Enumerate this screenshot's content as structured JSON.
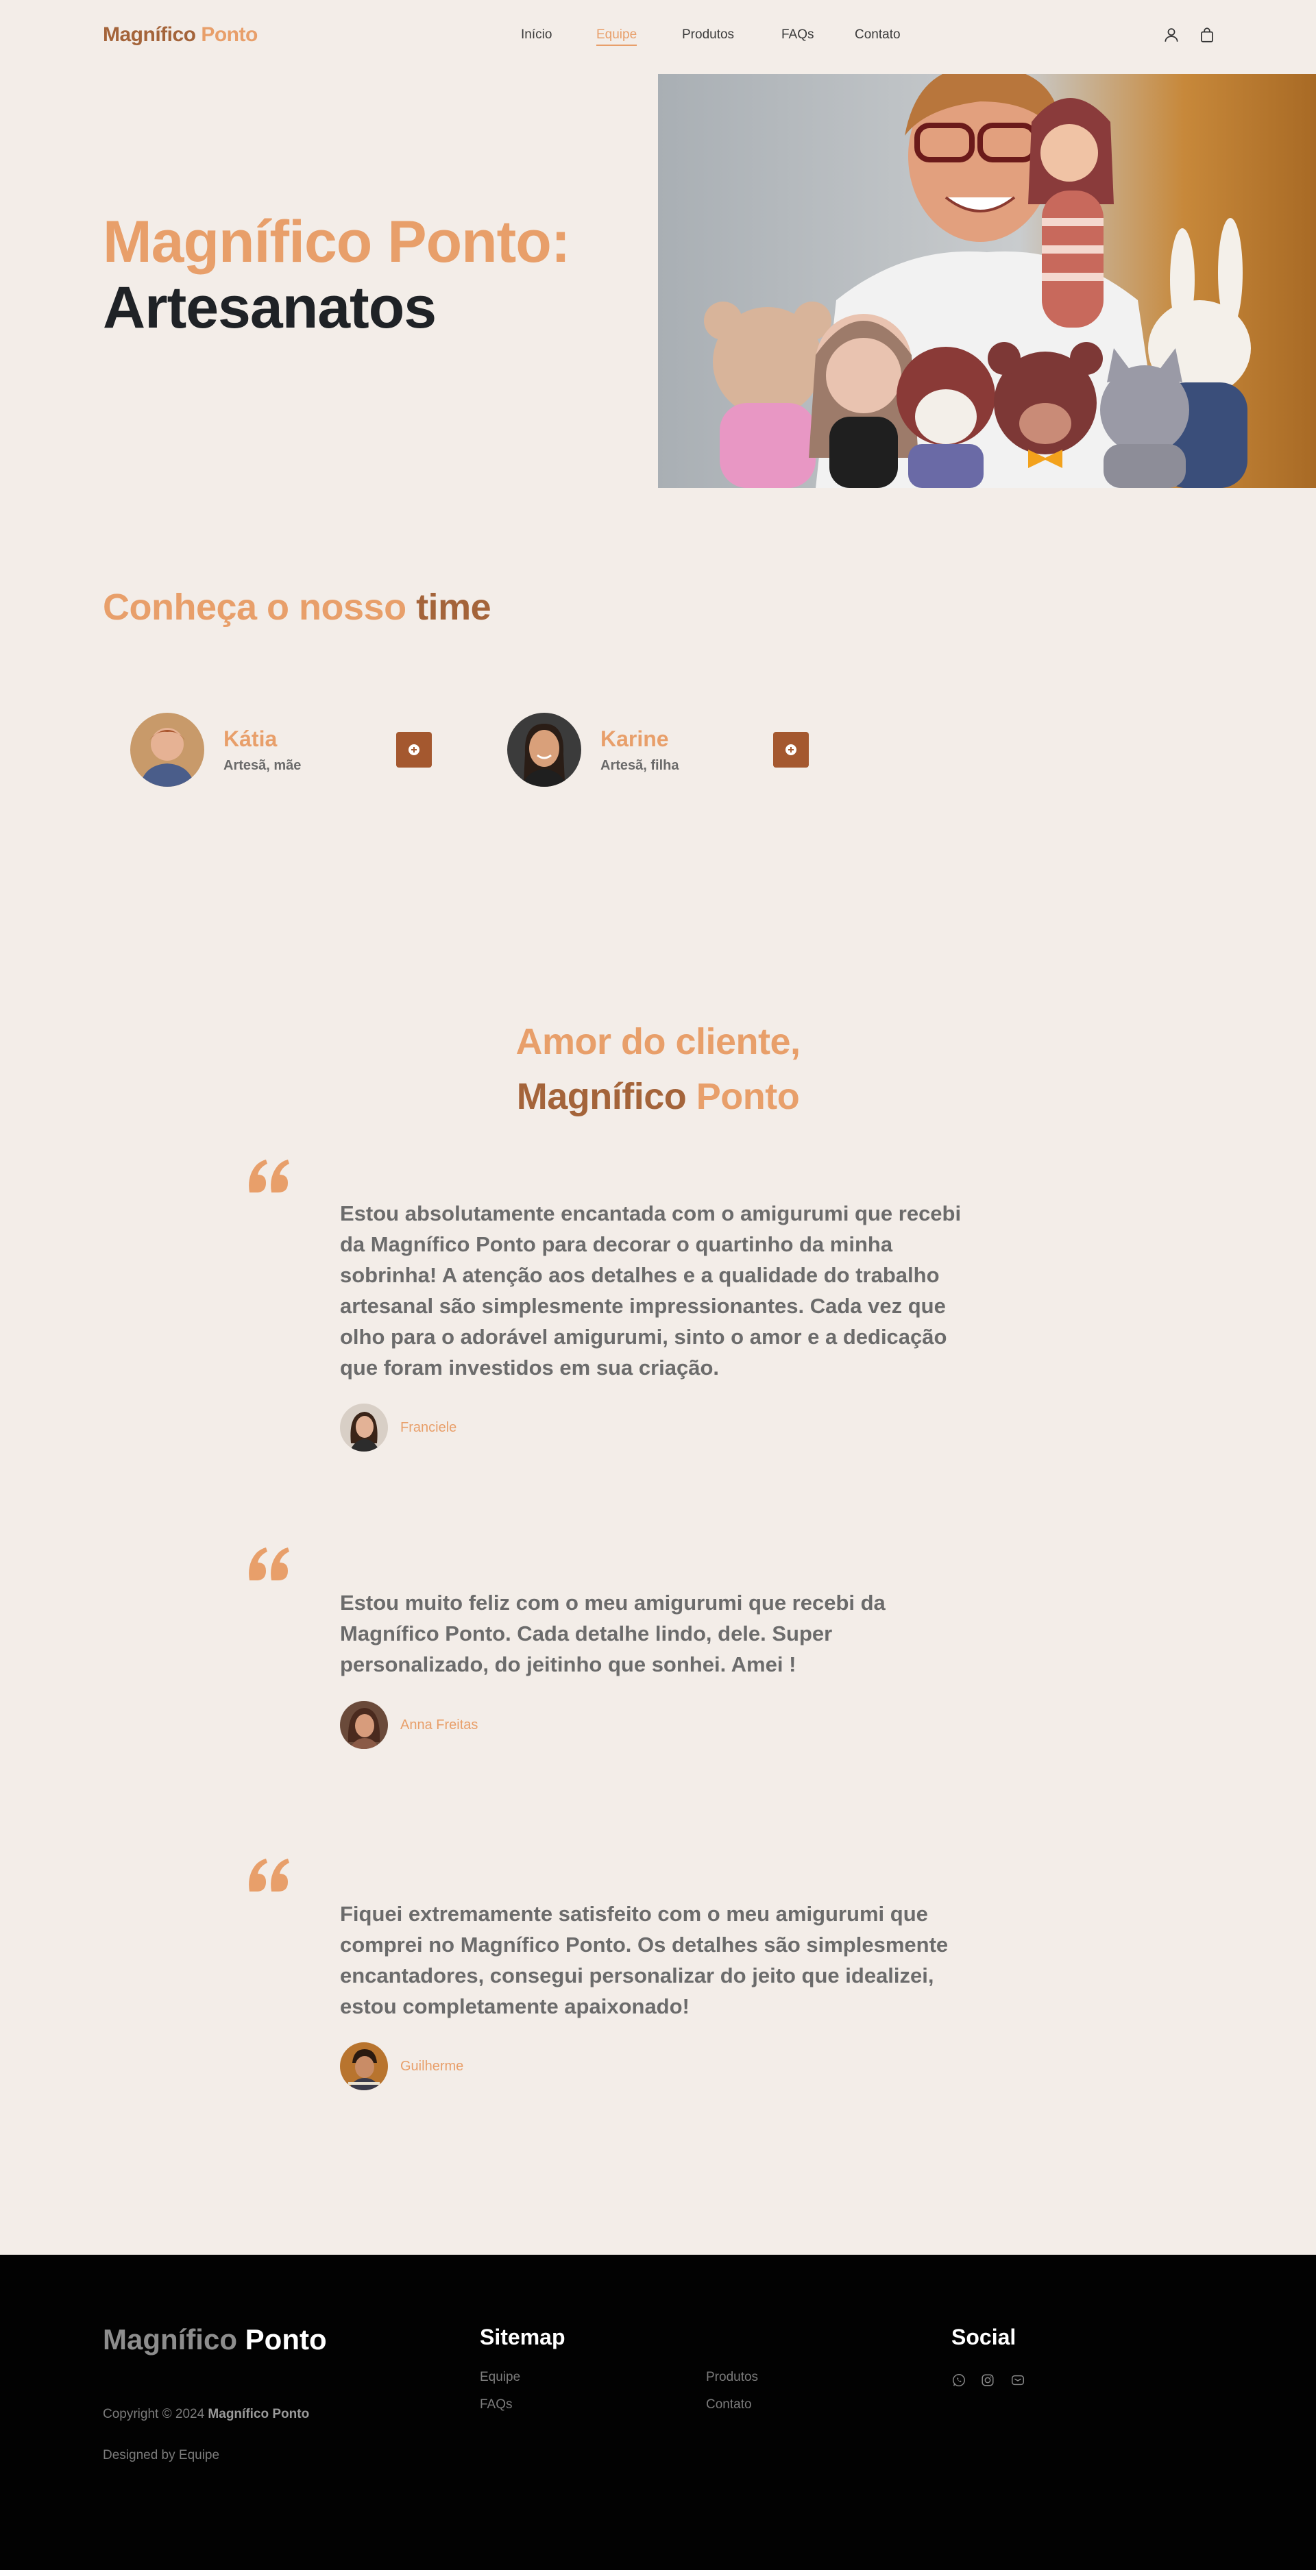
{
  "header": {
    "logo_a": "Magnífico",
    "logo_b": "Ponto",
    "nav": [
      "Início",
      "Equipe",
      "Produtos",
      "FAQs",
      "Contato"
    ],
    "active_nav": "Equipe",
    "icons": [
      "user-icon",
      "shopping-bag-icon"
    ]
  },
  "hero": {
    "title_line1": "Magnífico Ponto:",
    "title_line2": "Artesanatos",
    "image": "artisan-with-amigurumi-dolls-photo"
  },
  "team": {
    "title_a": "Conheça o nosso",
    "title_b": "time",
    "members": [
      {
        "name": "Kátia",
        "role": "Artesã, mãe"
      },
      {
        "name": "Karine",
        "role": "Artesã, filha"
      }
    ]
  },
  "testimonials": {
    "title_line1": "Amor do cliente,",
    "title_line2_a": "Magnífico",
    "title_line2_b": "Ponto",
    "items": [
      {
        "text": "Estou absolutamente encantada com o amigurumi que recebi da Magnífico Ponto para decorar o quartinho da minha sobrinha! A atenção aos detalhes e a qualidade do trabalho artesanal são simplesmente impressionantes. Cada vez que olho para o adorável amigurumi, sinto o amor e a dedicação que foram investidos em sua criação.",
        "author": "Franciele"
      },
      {
        "text": "Estou muito feliz com o meu amigurumi que recebi da Magnífico Ponto. Cada detalhe lindo, dele. Super personalizado, do jeitinho que sonhei. Amei !",
        "author": "Anna Freitas"
      },
      {
        "text": "Fiquei extremamente satisfeito com o meu amigurumi que comprei no Magnífico Ponto. Os detalhes são simplesmente encantadores, consegui personalizar do jeito que idealizei, estou completamente apaixonado!",
        "author": "Guilherme"
      }
    ]
  },
  "footer": {
    "logo_a": "Magnífico",
    "logo_b": "Ponto",
    "copyright": "Copyright © 2024",
    "copyright_brand": "Magnífico Ponto",
    "designed": "Designed by Equipe",
    "sitemap_title": "Sitemap",
    "sitemap_links": [
      "Equipe",
      "Produtos",
      "FAQs",
      "Contato"
    ],
    "social_title": "Social",
    "social_icons": [
      "whatsapp-icon",
      "instagram-icon",
      "email-icon"
    ]
  },
  "colors": {
    "background": "#f3ede8",
    "accent_light": "#e89f6a",
    "accent_dark": "#a4643a",
    "button": "#a4582f",
    "footer_bg": "#020202"
  }
}
